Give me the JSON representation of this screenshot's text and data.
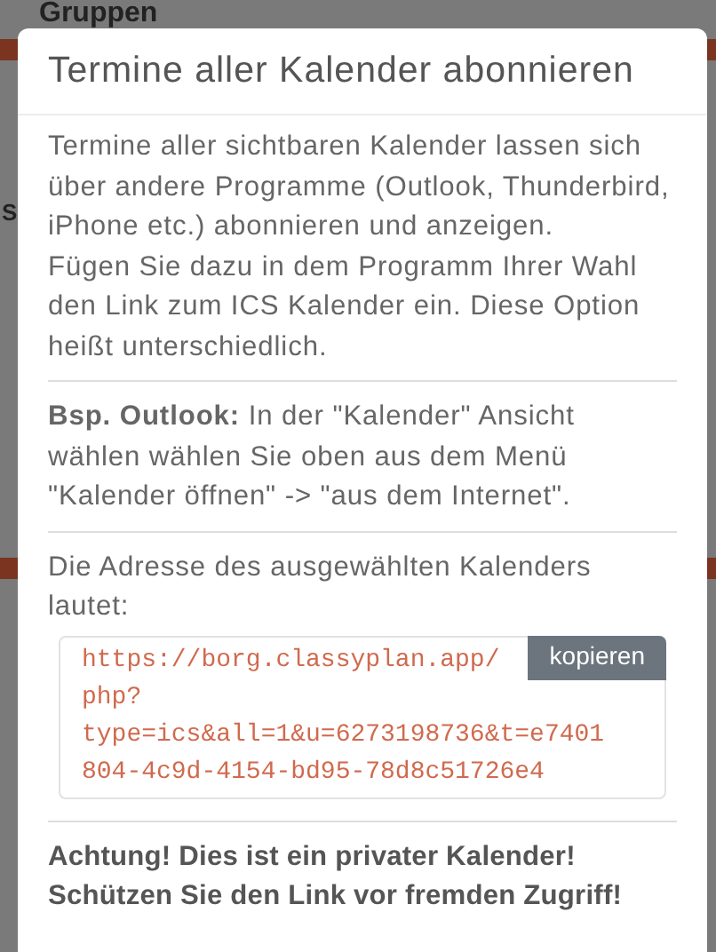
{
  "background": {
    "heading": "Gruppen",
    "side_text": "S"
  },
  "modal": {
    "title": "Termine aller Kalender abonnieren",
    "intro": [
      "Termine aller sichtbaren Kalender lassen sich über andere Programme (Outlook, Thunderbird, iPhone etc.) abonnieren und anzeigen.",
      "Fügen Sie dazu in dem Programm Ihrer Wahl den Link zum ICS Kalender ein. Diese Option heißt unterschiedlich."
    ],
    "example": "**Bsp. Outlook:** In der \"Kalender\" Ansicht wählen wählen Sie oben aus dem Menü \"Kalender öffnen\" -> \"aus dem Internet\".",
    "address_label": "Die Adresse des ausgewählten Kalenders lautet:",
    "url_lines": [
      "https://borg.classyplan.app/",
      "php?",
      "type=ics&all=1&u=6273198736&t=e7401",
      "804-4c9d-4154-bd95-78d8c51726e4"
    ],
    "copy_button": "kopieren",
    "warning": [
      "Achtung! Dies ist ein privater Kalender!",
      "Schützen Sie den Link vor fremden Zugriff!"
    ]
  }
}
